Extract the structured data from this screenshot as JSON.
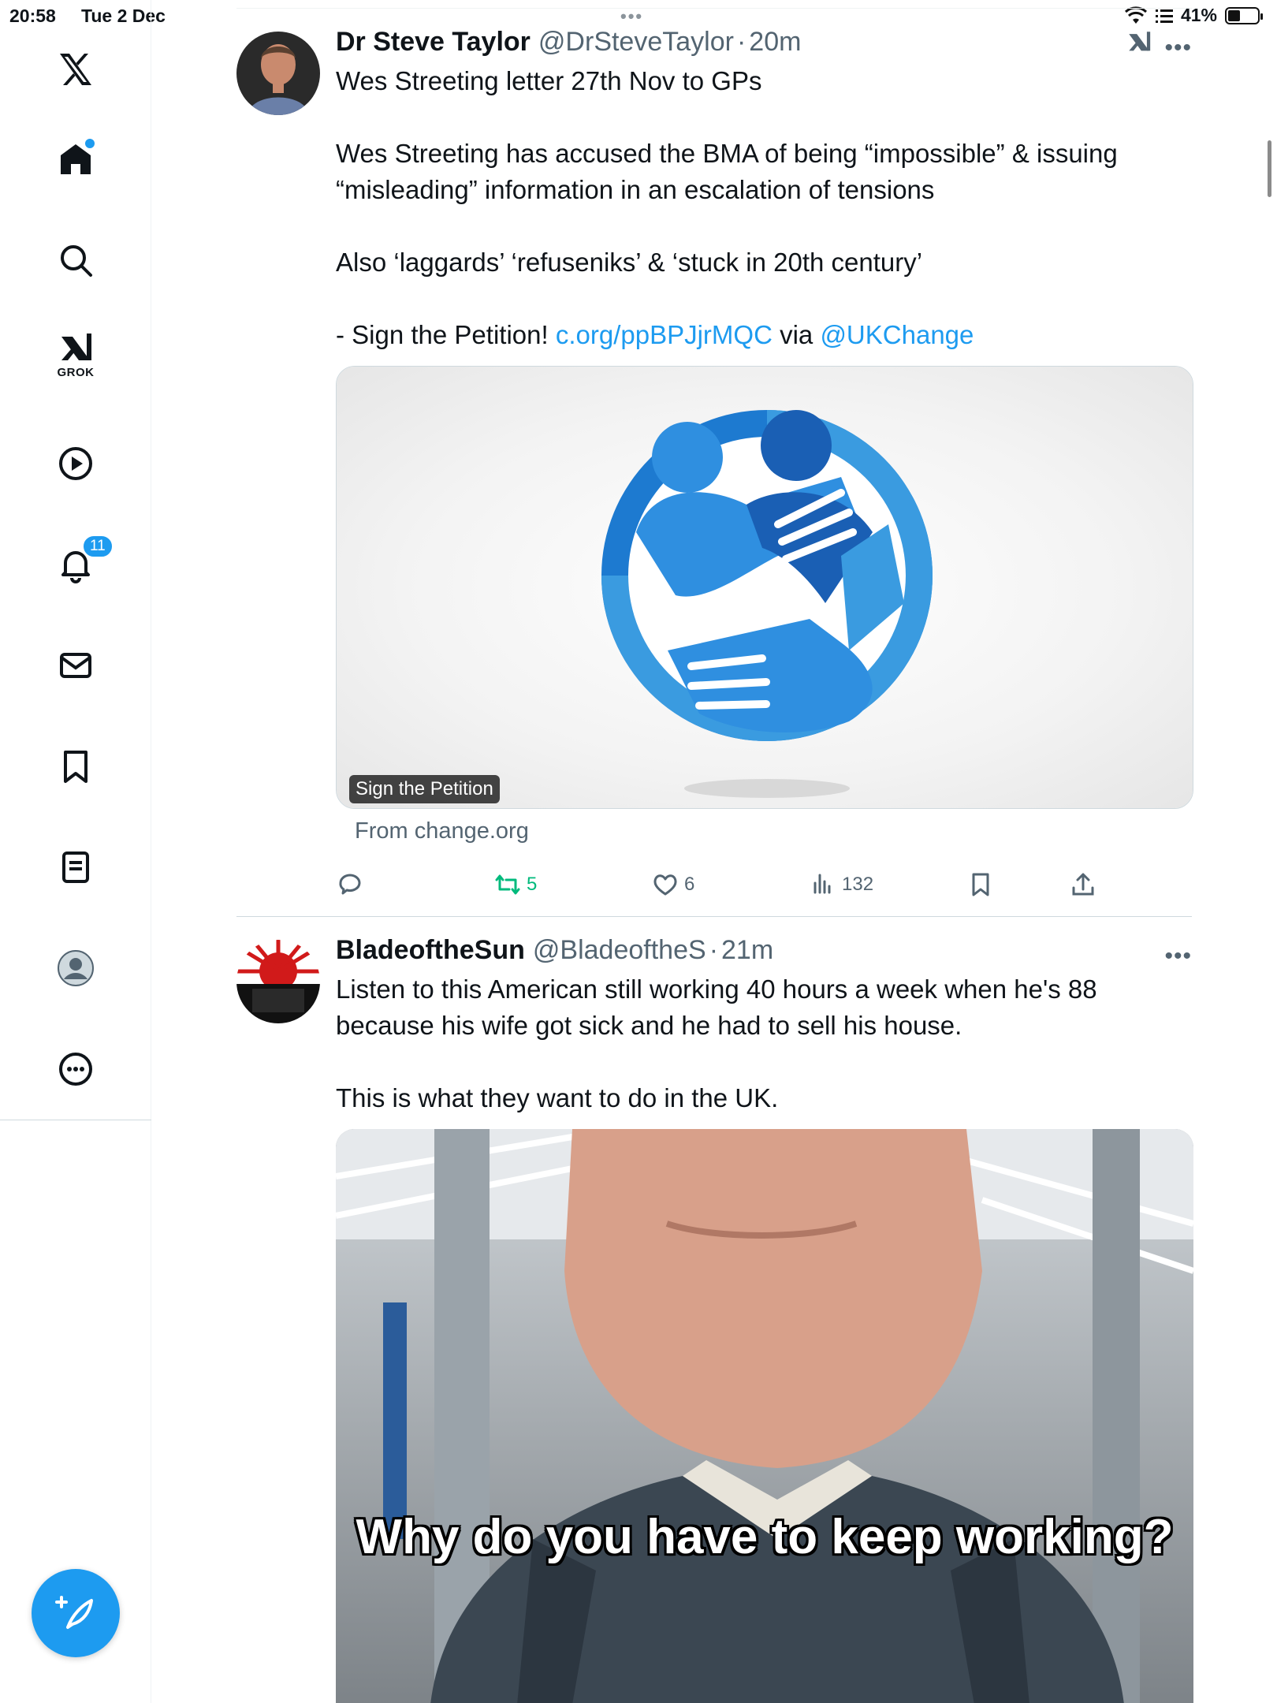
{
  "status_bar": {
    "time": "20:58",
    "date": "Tue 2 Dec",
    "battery_pct": "41%",
    "battery_level": 0.41
  },
  "sidebar": {
    "grok_label": "GROK",
    "notifications_badge": "11"
  },
  "tweets": [
    {
      "name": "Dr Steve Taylor",
      "handle": "@DrSteveTaylor",
      "separator": "·",
      "time": "20m",
      "text_1": "Wes Streeting letter 27th Nov to GPs\n\nWes Streeting has accused the BMA of being “impossible” &  issuing “misleading” information in an escalation of tensions\n\nAlso ‘laggards’ ‘refuseniks’ & ‘stuck in 20th century’\n\n - Sign the Petition! ",
      "link_1": "c.org/ppBPJjrMQC",
      "text_2": " via ",
      "link_2": "@UKChange",
      "card": {
        "tag": "Sign the Petition",
        "source": "From change.org"
      },
      "actions": {
        "retweets": "5",
        "likes": "6",
        "views": "132"
      }
    },
    {
      "name": "BladeoftheSun",
      "handle": "@BladeoftheS",
      "separator": "·",
      "time": "21m",
      "text": "Listen to this American still working 40 hours a week when he's 88 because his wife got sick and he had to sell his house.\n\nThis is what they want to do in the UK.",
      "video_caption": "Why do you have to keep working?"
    }
  ],
  "colors": {
    "accent": "#1d9bf0",
    "retweet": "#00ba7c",
    "muted": "#536471"
  }
}
